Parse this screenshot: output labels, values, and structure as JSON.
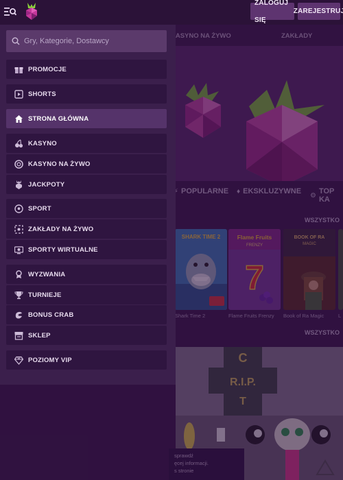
{
  "topbar": {
    "login_label": "ZALOGUJ SIĘ",
    "register_label": "ZAREJESTRUJ"
  },
  "search": {
    "placeholder": "Gry, Kategorie, Dostawcy"
  },
  "sidebar": {
    "items": [
      {
        "label": "PROMOCJE",
        "icon": "gift-icon"
      },
      {
        "label": "SHORTS",
        "icon": "shorts-icon"
      },
      {
        "label": "STRONA GŁÓWNA",
        "icon": "home-icon",
        "active": true
      },
      {
        "label": "KASYNO",
        "icon": "cherries-icon"
      },
      {
        "label": "KASYNO NA ŻYWO",
        "icon": "chip-icon"
      },
      {
        "label": "JACKPOTY",
        "icon": "raspberry-icon"
      },
      {
        "label": "SPORT",
        "icon": "soccer-ball-icon"
      },
      {
        "label": "ZAKŁADY NA ŻYWO",
        "icon": "live-bet-icon"
      },
      {
        "label": "SPORTY WIRTUALNE",
        "icon": "virtual-sports-icon"
      },
      {
        "label": "WYZWANIA",
        "icon": "medal-icon"
      },
      {
        "label": "TURNIEJE",
        "icon": "trophy-icon"
      },
      {
        "label": "BONUS CRAB",
        "icon": "crab-claw-icon"
      },
      {
        "label": "SKLEP",
        "icon": "shop-icon"
      },
      {
        "label": "POZIOMY VIP",
        "icon": "diamond-icon"
      }
    ]
  },
  "background": {
    "subnav": [
      "KASYNO NA ŻYWO",
      "ZAKŁADY"
    ],
    "category_tabs": [
      "POPULARNE",
      "EKSKLUZYWNE",
      "TOP KA"
    ],
    "all_link_1": "WSZYSTKO",
    "all_link_2": "WSZYSTKO",
    "games": [
      {
        "title": "Shark Time 2",
        "art_text": "SHARK TIME 2"
      },
      {
        "title": "Flame Fruits Frenzy",
        "art_text": "Flame Fruits FRENZY"
      },
      {
        "title": "Book of Ra Magic",
        "art_text": "BOOK OF RA MAGIC"
      },
      {
        "title": "L"
      }
    ],
    "promo_sign": "C I T Y",
    "promo_rip": "R.I.P.",
    "tooltip_lines": [
      "sprawdź",
      "ęcej informacji.",
      "s stronie"
    ]
  },
  "colors": {
    "page_bg": "#2a1136",
    "sidebar_bg": "#3b1f4c",
    "menu_item_bg": "#2f1540",
    "menu_item_active_bg": "#55336a",
    "button_bg": "#5e3470"
  }
}
